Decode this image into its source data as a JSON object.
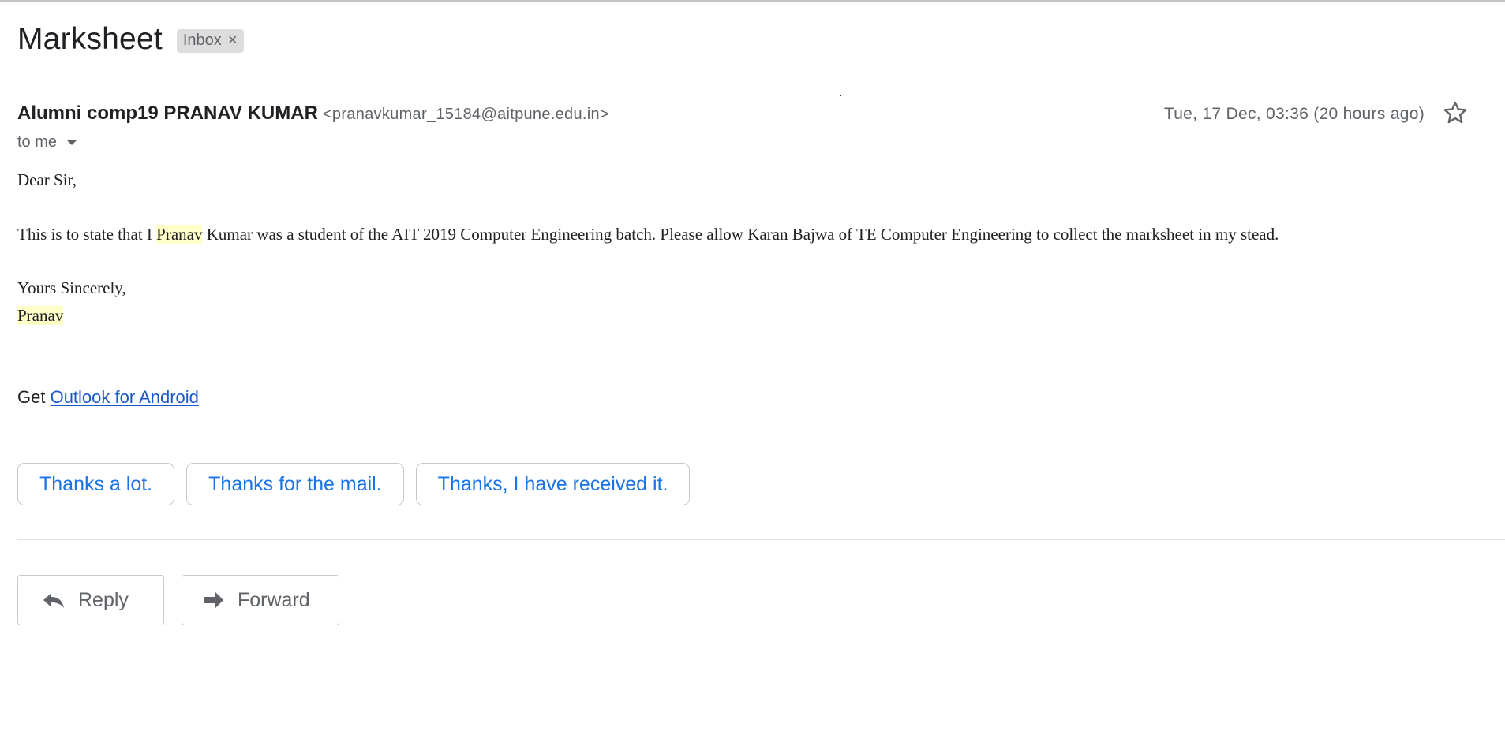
{
  "email": {
    "subject": "Marksheet",
    "label": "Inbox",
    "label_remove": "×",
    "sender_name": "Alumni comp19 PRANAV KUMAR",
    "sender_email": "<pranavkumar_15184@aitpune.edu.in>",
    "date": "Tue, 17 Dec, 03:36 (20 hours ago)",
    "recipient": "to me"
  },
  "body": {
    "greeting": "Dear Sir,",
    "main_pre": "This is to state that I ",
    "main_highlight": "Pranav",
    "main_post": " Kumar was a student of the AIT 2019 Computer Engineering batch. Please allow Karan Bajwa of TE Computer Engineering to collect the marksheet in my stead.",
    "closing": "Yours Sincerely,",
    "signature": "Pranav",
    "get_prefix": "Get ",
    "get_link": "Outlook for Android"
  },
  "smart_replies": [
    "Thanks a lot.",
    "Thanks for the mail.",
    "Thanks, I have received it."
  ],
  "actions": {
    "reply": "Reply",
    "forward": "Forward"
  },
  "icons": {
    "star": "star-outline-icon",
    "reply": "reply-arrow-icon",
    "forward": "forward-arrow-icon"
  },
  "colors": {
    "link": "#1a57c9",
    "smart_reply_text": "#1a73e8",
    "highlight": "#ffffc8"
  }
}
